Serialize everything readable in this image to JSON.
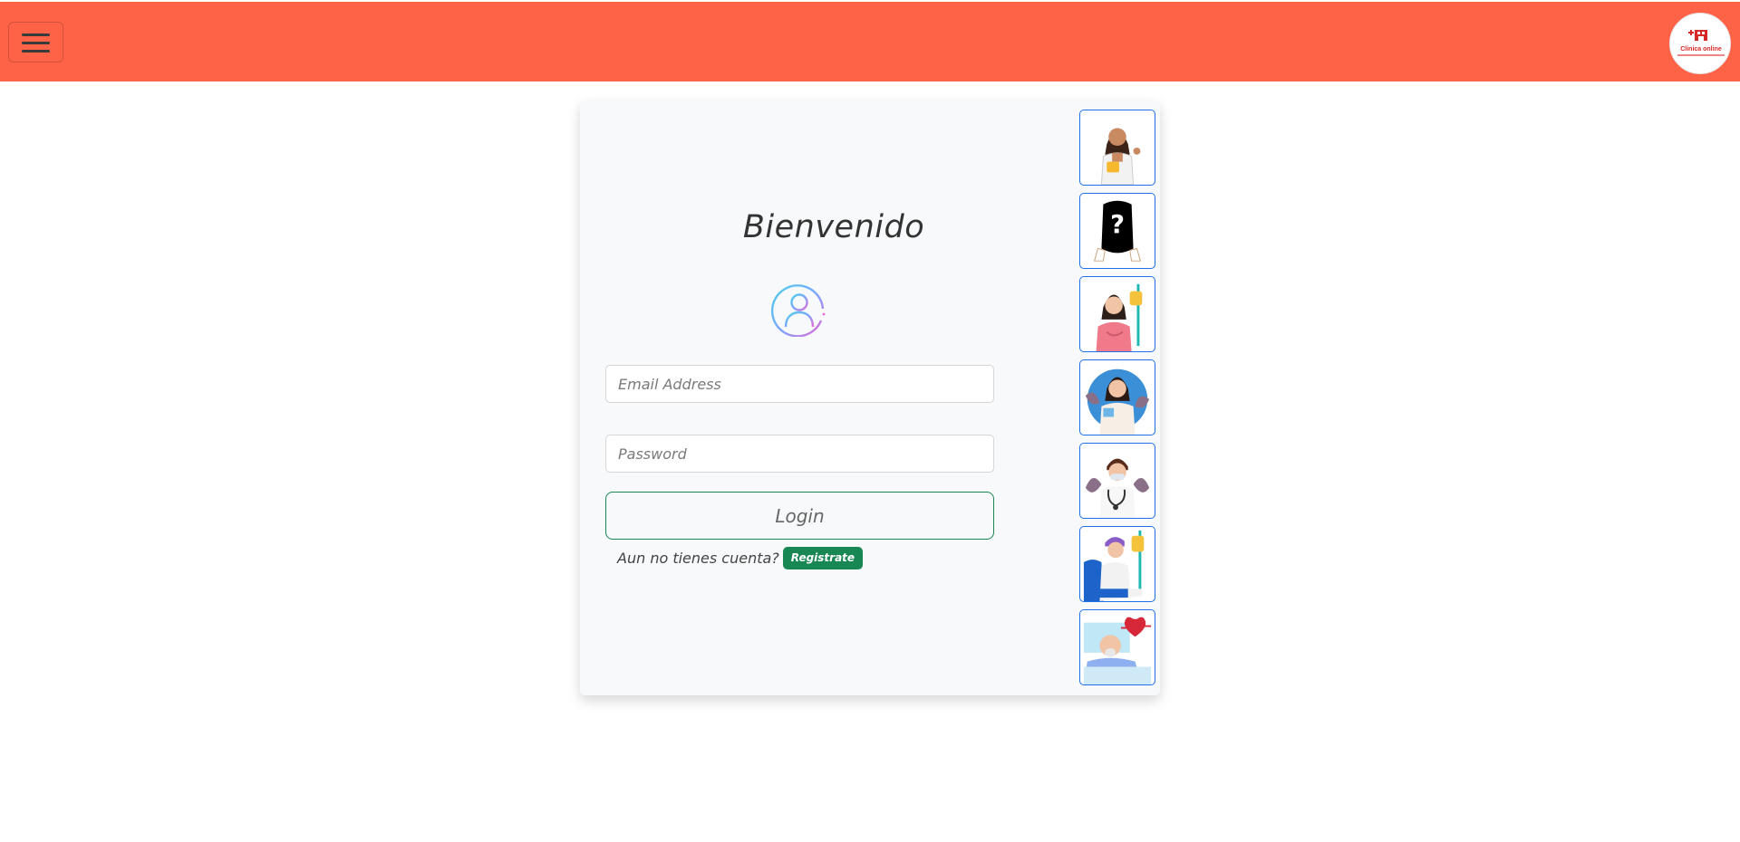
{
  "header": {
    "menu_icon": "hamburger-icon",
    "brand_color": "#ff6347",
    "logo": {
      "text": "Clinica online",
      "subtext": ""
    }
  },
  "login": {
    "title": "Bienvenido",
    "avatar_icon": "user-circle-icon",
    "email": {
      "placeholder": "Email Address",
      "value": ""
    },
    "password": {
      "placeholder": "Password",
      "value": ""
    },
    "login_label": "Login",
    "signup_question": "Aun no tienes cuenta?",
    "signup_label": "Registrate",
    "accent_color": "#198754"
  },
  "quick_users": [
    {
      "icon": "doctor-woman-avatar"
    },
    {
      "icon": "unknown-user-avatar"
    },
    {
      "icon": "patient-woman-iv-avatar"
    },
    {
      "icon": "doctor-woman-plants-avatar"
    },
    {
      "icon": "doctor-man-stethoscope-avatar"
    },
    {
      "icon": "patient-man-iv-avatar"
    },
    {
      "icon": "patient-elderly-heart-avatar"
    }
  ]
}
